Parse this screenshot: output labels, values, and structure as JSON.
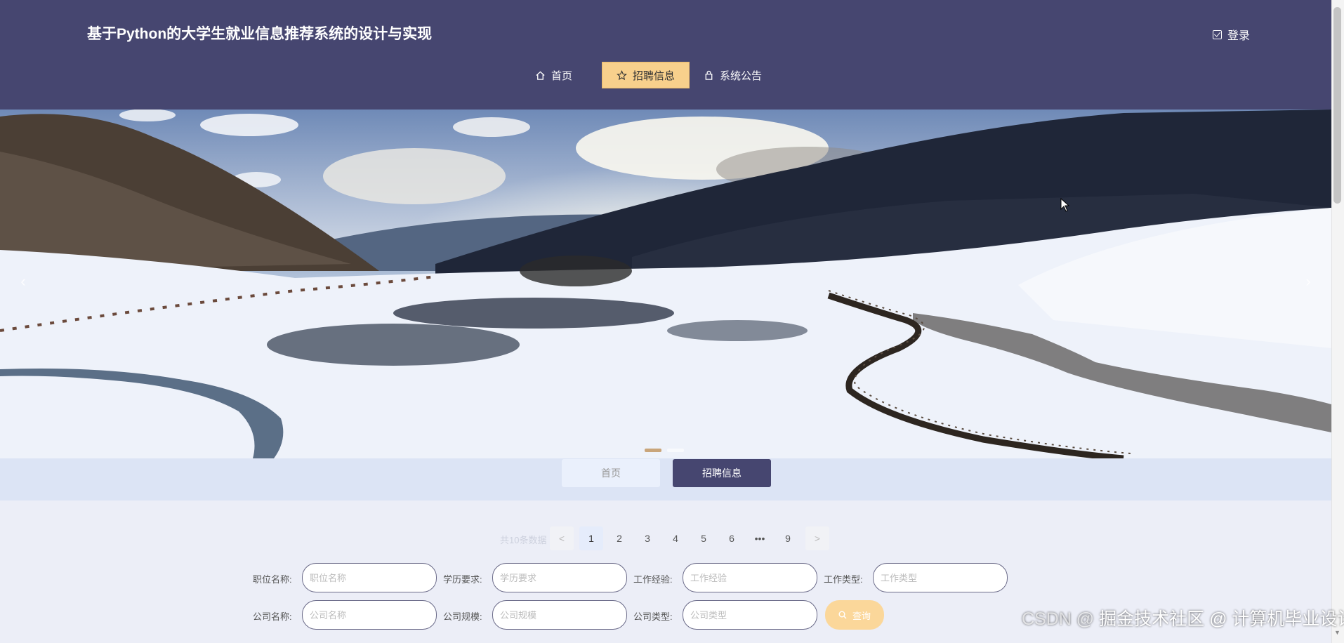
{
  "header": {
    "title": "基于Python的大学生就业信息推荐系统的设计与实现",
    "login_label": "登录",
    "nav": [
      {
        "label": "首页",
        "icon": "home-icon",
        "active": false
      },
      {
        "label": "招聘信息",
        "icon": "star-icon",
        "active": true
      },
      {
        "label": "系统公告",
        "icon": "bag-icon",
        "active": false
      }
    ]
  },
  "banner": {
    "prev_icon": "chevron-left-icon",
    "next_icon": "chevron-right-icon",
    "active_slide": 1,
    "slide_count": 2
  },
  "tabs": {
    "home_label": "首页",
    "jobs_label": "招聘信息"
  },
  "pagination": {
    "total_text": "共10条数据",
    "prev": "<",
    "pages": [
      "1",
      "2",
      "3",
      "4",
      "5",
      "6",
      "•••",
      "9"
    ],
    "current_page": "1",
    "next": ">"
  },
  "filters": {
    "job_name": {
      "label": "职位名称:",
      "placeholder": "职位名称",
      "value": ""
    },
    "education": {
      "label": "学历要求:",
      "placeholder": "学历要求",
      "value": ""
    },
    "experience": {
      "label": "工作经验:",
      "placeholder": "工作经验",
      "value": ""
    },
    "job_type": {
      "label": "工作类型:",
      "placeholder": "工作类型",
      "value": ""
    },
    "company_name": {
      "label": "公司名称:",
      "placeholder": "公司名称",
      "value": ""
    },
    "company_size": {
      "label": "公司规模:",
      "placeholder": "公司规模",
      "value": ""
    },
    "company_type": {
      "label": "公司类型:",
      "placeholder": "公司类型",
      "value": ""
    },
    "search_label": "查询"
  },
  "watermark": {
    "prefix": "CSDN @",
    "text": "掘金技术社区 @ 计算机毕业设计小明哥"
  },
  "colors": {
    "header_bg": "#464670",
    "accent": "#f8d08c",
    "tab_dark": "#464670",
    "band_bg": "#dce4f5",
    "page_bg": "#eceef7"
  }
}
